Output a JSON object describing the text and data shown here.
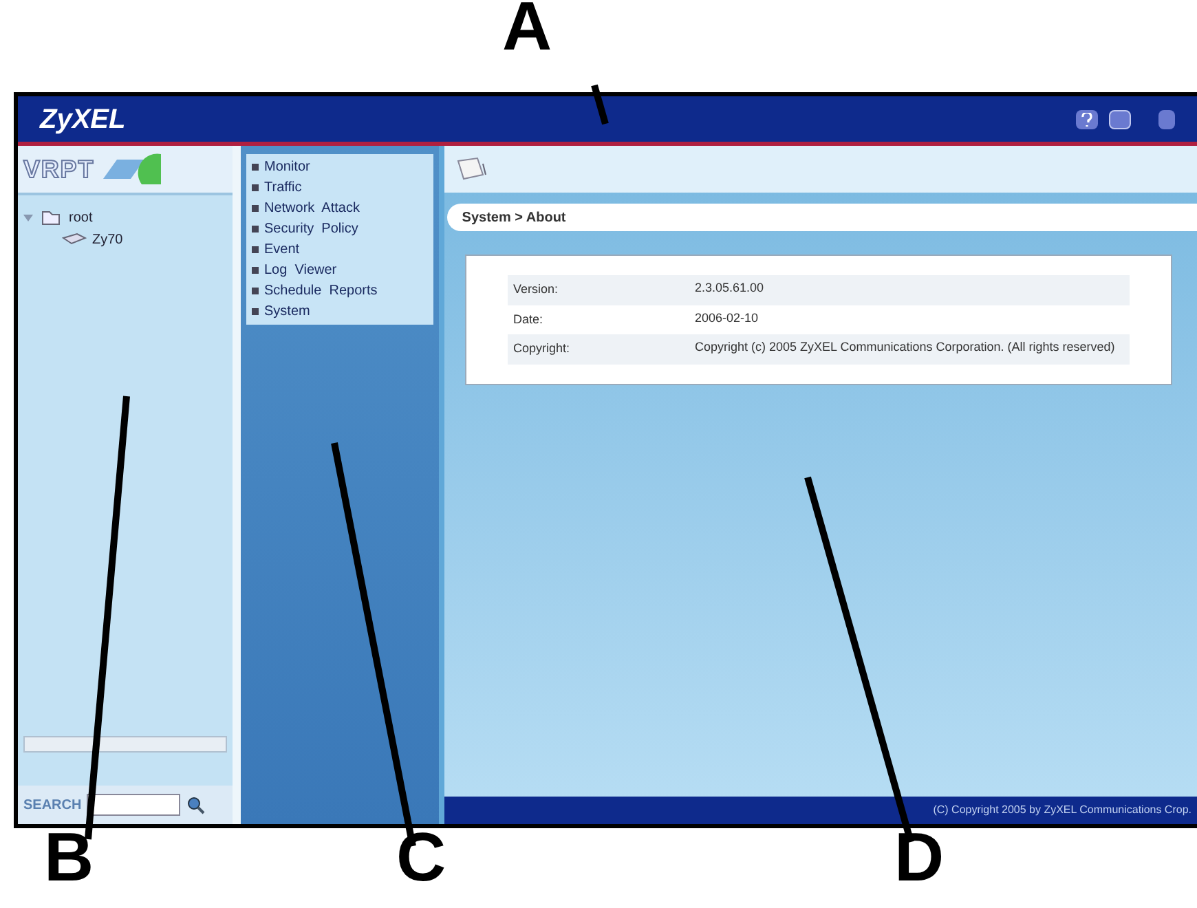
{
  "callouts": [
    {
      "label": "A"
    },
    {
      "label": "B"
    },
    {
      "label": "C"
    },
    {
      "label": "D"
    }
  ],
  "header": {
    "logo": "ZyXEL"
  },
  "sidebar": {
    "logo": "VRPT",
    "tree": [
      {
        "label": "root",
        "expanded": true,
        "children": [
          {
            "label": "Zy70"
          }
        ]
      }
    ],
    "search_label": "SEARCH"
  },
  "menu": {
    "items": [
      {
        "label": "Monitor"
      },
      {
        "label": "Traffic"
      },
      {
        "label": "Network  Attack"
      },
      {
        "label": "Security  Policy"
      },
      {
        "label": "Event"
      },
      {
        "label": "Log  Viewer"
      },
      {
        "label": "Schedule  Reports"
      },
      {
        "label": "System"
      }
    ]
  },
  "breadcrumb": "System > About",
  "about": [
    {
      "label": "Version:",
      "value": "2.3.05.61.00"
    },
    {
      "label": "Date:",
      "value": "2006-02-10"
    },
    {
      "label": "Copyright:",
      "value": "Copyright (c) 2005 ZyXEL Communications Corporation. (All rights reserved)"
    }
  ],
  "footer": "(C) Copyright 2005 by ZyXEL Communications Crop."
}
